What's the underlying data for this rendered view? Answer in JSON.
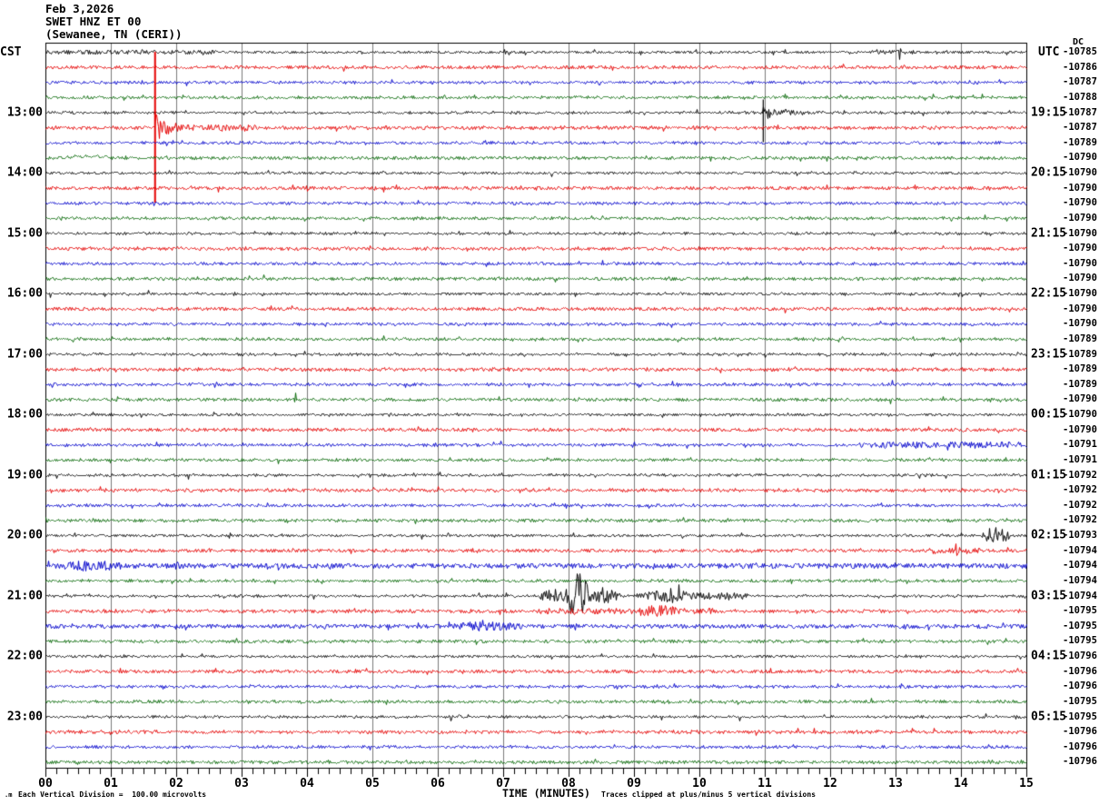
{
  "header": {
    "date": "Feb 3,2026",
    "station": "SWET HNZ ET 00",
    "location": "(Sewanee, TN (CERI))",
    "left_axis": "CST",
    "right_axis": "UTC",
    "dc_header": "DC"
  },
  "x_axis": {
    "label": "TIME (MINUTES)",
    "ticks": [
      "00",
      "01",
      "02",
      "03",
      "04",
      "05",
      "06",
      "07",
      "08",
      "09",
      "10",
      "11",
      "12",
      "13",
      "14",
      "15"
    ]
  },
  "footer": {
    "left": "Each Vertical Division =  100.00 microvolts",
    "right": "Traces clipped at plus/minus 5 vertical divisions",
    "corner_mark": ".m"
  },
  "colors": {
    "black": "#000000",
    "red": "#e60000",
    "blue": "#0000cc",
    "green": "#066806",
    "grid": "#7a7a7a",
    "frame": "#000000"
  },
  "chart_data": {
    "type": "line",
    "variant": "helicorder-seismogram",
    "title": "SWET HNZ ET 00 (Sewanee, TN (CERI)) Feb 3,2026",
    "x_range_minutes": [
      0,
      15
    ],
    "minutes_per_line": 15,
    "grid": "on",
    "cst_labels": [
      {
        "row": 4,
        "label": "13:00"
      },
      {
        "row": 8,
        "label": "14:00"
      },
      {
        "row": 12,
        "label": "15:00"
      },
      {
        "row": 16,
        "label": "16:00"
      },
      {
        "row": 20,
        "label": "17:00"
      },
      {
        "row": 24,
        "label": "18:00"
      },
      {
        "row": 28,
        "label": "19:00"
      },
      {
        "row": 32,
        "label": "20:00"
      },
      {
        "row": 36,
        "label": "21:00"
      },
      {
        "row": 40,
        "label": "22:00"
      },
      {
        "row": 44,
        "label": "23:00"
      }
    ],
    "utc_labels": [
      {
        "row": 4,
        "label": "19:15"
      },
      {
        "row": 8,
        "label": "20:15"
      },
      {
        "row": 12,
        "label": "21:15"
      },
      {
        "row": 16,
        "label": "22:15"
      },
      {
        "row": 20,
        "label": "23:15"
      },
      {
        "row": 24,
        "label": "00:15"
      },
      {
        "row": 28,
        "label": "01:15"
      },
      {
        "row": 32,
        "label": "02:15"
      },
      {
        "row": 36,
        "label": "03:15"
      },
      {
        "row": 40,
        "label": "04:15"
      },
      {
        "row": 44,
        "label": "05:15"
      }
    ],
    "rows": [
      {
        "color": "black",
        "dc": "-10785",
        "events": [
          {
            "type": "noise",
            "t0": 0,
            "t1": 2.6,
            "amp": 1.1
          },
          {
            "type": "noise",
            "t0": 12.6,
            "t1": 13.3,
            "amp": 1.4
          },
          {
            "type": "spike",
            "t": 13.06,
            "amp": 7
          }
        ]
      },
      {
        "color": "red",
        "dc": "-10786",
        "events": []
      },
      {
        "color": "blue",
        "dc": "-10787",
        "events": []
      },
      {
        "color": "green",
        "dc": "-10788",
        "events": []
      },
      {
        "color": "black",
        "dc": "-10787",
        "events": [
          {
            "type": "vspike",
            "t": 10.97,
            "up": 14,
            "down": 33
          },
          {
            "type": "coda",
            "t0": 10.97,
            "t1": 11.9,
            "amp": 7
          }
        ]
      },
      {
        "color": "red",
        "dc": "-10787",
        "events": [
          {
            "type": "vspike",
            "t": 1.67,
            "up": 83,
            "down": 83
          },
          {
            "type": "coda",
            "t0": 1.67,
            "t1": 2.45,
            "amp": 15
          },
          {
            "type": "noise",
            "t0": 2.45,
            "t1": 3.2,
            "amp": 2
          }
        ]
      },
      {
        "color": "blue",
        "dc": "-10789",
        "events": []
      },
      {
        "color": "green",
        "dc": "-10790",
        "events": [
          {
            "type": "bump",
            "t0": 0.15,
            "t1": 1.05,
            "amp": 3
          }
        ]
      },
      {
        "color": "black",
        "dc": "-10790",
        "events": []
      },
      {
        "color": "red",
        "dc": "-10790",
        "events": []
      },
      {
        "color": "blue",
        "dc": "-10790",
        "events": []
      },
      {
        "color": "green",
        "dc": "-10790",
        "events": []
      },
      {
        "color": "black",
        "dc": "-10790",
        "events": []
      },
      {
        "color": "red",
        "dc": "-10790",
        "events": []
      },
      {
        "color": "blue",
        "dc": "-10790",
        "events": []
      },
      {
        "color": "green",
        "dc": "-10790",
        "events": []
      },
      {
        "color": "black",
        "dc": "-10790",
        "events": []
      },
      {
        "color": "red",
        "dc": "-10790",
        "events": []
      },
      {
        "color": "blue",
        "dc": "-10790",
        "events": []
      },
      {
        "color": "green",
        "dc": "-10789",
        "events": []
      },
      {
        "color": "black",
        "dc": "-10789",
        "events": []
      },
      {
        "color": "red",
        "dc": "-10789",
        "events": []
      },
      {
        "color": "blue",
        "dc": "-10789",
        "events": []
      },
      {
        "color": "green",
        "dc": "-10790",
        "events": [
          {
            "type": "spike",
            "t": 3.82,
            "amp": 6
          }
        ]
      },
      {
        "color": "black",
        "dc": "-10790",
        "events": []
      },
      {
        "color": "red",
        "dc": "-10790",
        "events": []
      },
      {
        "color": "blue",
        "dc": "-10791",
        "events": [
          {
            "type": "noise",
            "t0": 12.4,
            "t1": 15,
            "amp": 1.9
          }
        ]
      },
      {
        "color": "green",
        "dc": "-10791",
        "events": []
      },
      {
        "color": "black",
        "dc": "-10792",
        "events": []
      },
      {
        "color": "red",
        "dc": "-10792",
        "events": []
      },
      {
        "color": "blue",
        "dc": "-10792",
        "events": []
      },
      {
        "color": "green",
        "dc": "-10792",
        "events": []
      },
      {
        "color": "black",
        "dc": "-10793",
        "events": [
          {
            "type": "burst",
            "t0": 14.3,
            "t1": 14.75,
            "amp": 8
          }
        ]
      },
      {
        "color": "red",
        "dc": "-10794",
        "events": [
          {
            "type": "spike",
            "t": 13.92,
            "amp": 8
          },
          {
            "type": "noise",
            "t0": 13.5,
            "t1": 14.3,
            "amp": 1.5
          }
        ]
      },
      {
        "color": "blue",
        "dc": "-10794",
        "events": [
          {
            "type": "noise",
            "t0": 0,
            "t1": 15,
            "amp": 1.2
          },
          {
            "type": "burst",
            "t0": 0.15,
            "t1": 1.2,
            "amp": 3.5
          },
          {
            "type": "spike",
            "t": 2.0,
            "amp": 5
          },
          {
            "type": "spike",
            "t": 3.4,
            "amp": 4
          }
        ]
      },
      {
        "color": "green",
        "dc": "-10794",
        "events": []
      },
      {
        "color": "black",
        "dc": "-10794",
        "events": [
          {
            "type": "burst",
            "t0": 7.55,
            "t1": 8.0,
            "amp": 7
          },
          {
            "type": "burst",
            "t0": 7.95,
            "t1": 8.35,
            "amp": 24
          },
          {
            "type": "burst",
            "t0": 8.3,
            "t1": 8.8,
            "amp": 7
          },
          {
            "type": "burst",
            "t0": 9.0,
            "t1": 10.05,
            "amp": 5
          },
          {
            "type": "spike",
            "t": 9.56,
            "amp": 13
          },
          {
            "type": "spike",
            "t": 9.68,
            "amp": 12
          },
          {
            "type": "noise",
            "t0": 10.0,
            "t1": 10.75,
            "amp": 2.5
          }
        ]
      },
      {
        "color": "red",
        "dc": "-10795",
        "events": [
          {
            "type": "noise",
            "t0": 7.5,
            "t1": 10.2,
            "amp": 1.5
          },
          {
            "type": "burst",
            "t0": 9.0,
            "t1": 9.7,
            "amp": 3
          }
        ]
      },
      {
        "color": "blue",
        "dc": "-10795",
        "events": [
          {
            "type": "noise",
            "t0": 0,
            "t1": 15,
            "amp": 0.8
          },
          {
            "type": "burst",
            "t0": 6.2,
            "t1": 7.3,
            "amp": 3
          },
          {
            "type": "spike",
            "t": 8.1,
            "amp": 4
          }
        ]
      },
      {
        "color": "green",
        "dc": "-10795",
        "events": []
      },
      {
        "color": "black",
        "dc": "-10796",
        "events": []
      },
      {
        "color": "red",
        "dc": "-10796",
        "events": []
      },
      {
        "color": "blue",
        "dc": "-10796",
        "events": [
          {
            "type": "spike",
            "t": 1.8,
            "amp": 4
          }
        ]
      },
      {
        "color": "green",
        "dc": "-10795",
        "events": []
      },
      {
        "color": "black",
        "dc": "-10795",
        "events": []
      },
      {
        "color": "red",
        "dc": "-10796",
        "events": []
      },
      {
        "color": "blue",
        "dc": "-10796",
        "events": []
      },
      {
        "color": "green",
        "dc": "-10796",
        "events": []
      }
    ]
  }
}
